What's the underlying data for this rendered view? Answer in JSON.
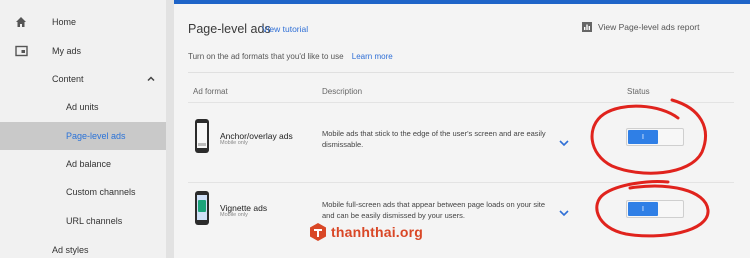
{
  "sidebar": {
    "items": [
      {
        "label": "Home",
        "icon": "home-icon"
      },
      {
        "label": "My ads",
        "icon": "ads-icon"
      },
      {
        "label": "Content",
        "icon": "chevron-up-icon"
      },
      {
        "label": "Ad units"
      },
      {
        "label": "Page-level ads"
      },
      {
        "label": "Ad balance"
      },
      {
        "label": "Custom channels"
      },
      {
        "label": "URL channels"
      },
      {
        "label": "Ad styles"
      }
    ]
  },
  "header": {
    "title": "Page-level ads",
    "tutorial_link": "View tutorial",
    "report_link": "View Page-level ads report",
    "accent_color": "#1e64c8"
  },
  "intro": {
    "text": "Turn on the ad formats that you'd like to use",
    "learn_more": "Learn more"
  },
  "table": {
    "columns": [
      "Ad format",
      "Description",
      "Status"
    ],
    "rows": [
      {
        "name": "Anchor/overlay ads",
        "sub": "Mobile only",
        "description": "Mobile ads that stick to the edge of the user's screen and are easily dismissable.",
        "status_label": "I",
        "enabled": true
      },
      {
        "name": "Vignette ads",
        "sub": "Mobile only",
        "description": "Mobile full-screen ads that appear between page loads on your site and can be easily dismissed by your users.",
        "status_label": "I",
        "enabled": true
      }
    ]
  },
  "watermark": {
    "text": "thanhthai.org",
    "color": "#d94726"
  }
}
